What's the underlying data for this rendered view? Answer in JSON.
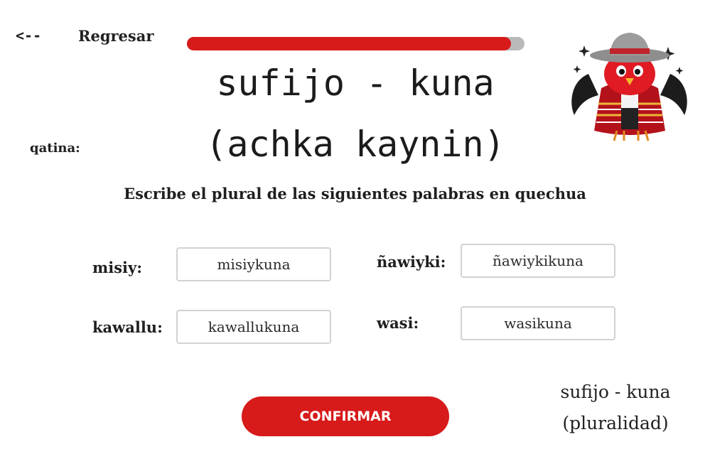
{
  "nav": {
    "back_arrow": "<--",
    "back_label": "Regresar"
  },
  "progress": {
    "fraction": 0.96
  },
  "title": {
    "line1": "sufijo - kuna",
    "line2": "(achka kaynin)"
  },
  "side_label": "qatina:",
  "instruction": "Escribe el plural de las siguientes palabras en quechua",
  "exercise": {
    "items": [
      {
        "label": "misiy:",
        "answer": "misiykuna"
      },
      {
        "label": "ñawiyki:",
        "answer": "ñawiykikuna"
      },
      {
        "label": "kawallu:",
        "answer": "kawallukuna"
      },
      {
        "label": "wasi:",
        "answer": "wasikuna"
      }
    ]
  },
  "confirm_label": "CONFIRMAR",
  "note": {
    "line1": "sufijo - kuna",
    "line2": "(pluralidad)"
  },
  "colors": {
    "accent": "#d71a1a",
    "track": "#b9b9b9",
    "box_border": "#d2d2d2"
  },
  "mascot": {
    "icon": "andean-bird-mascot-icon"
  }
}
